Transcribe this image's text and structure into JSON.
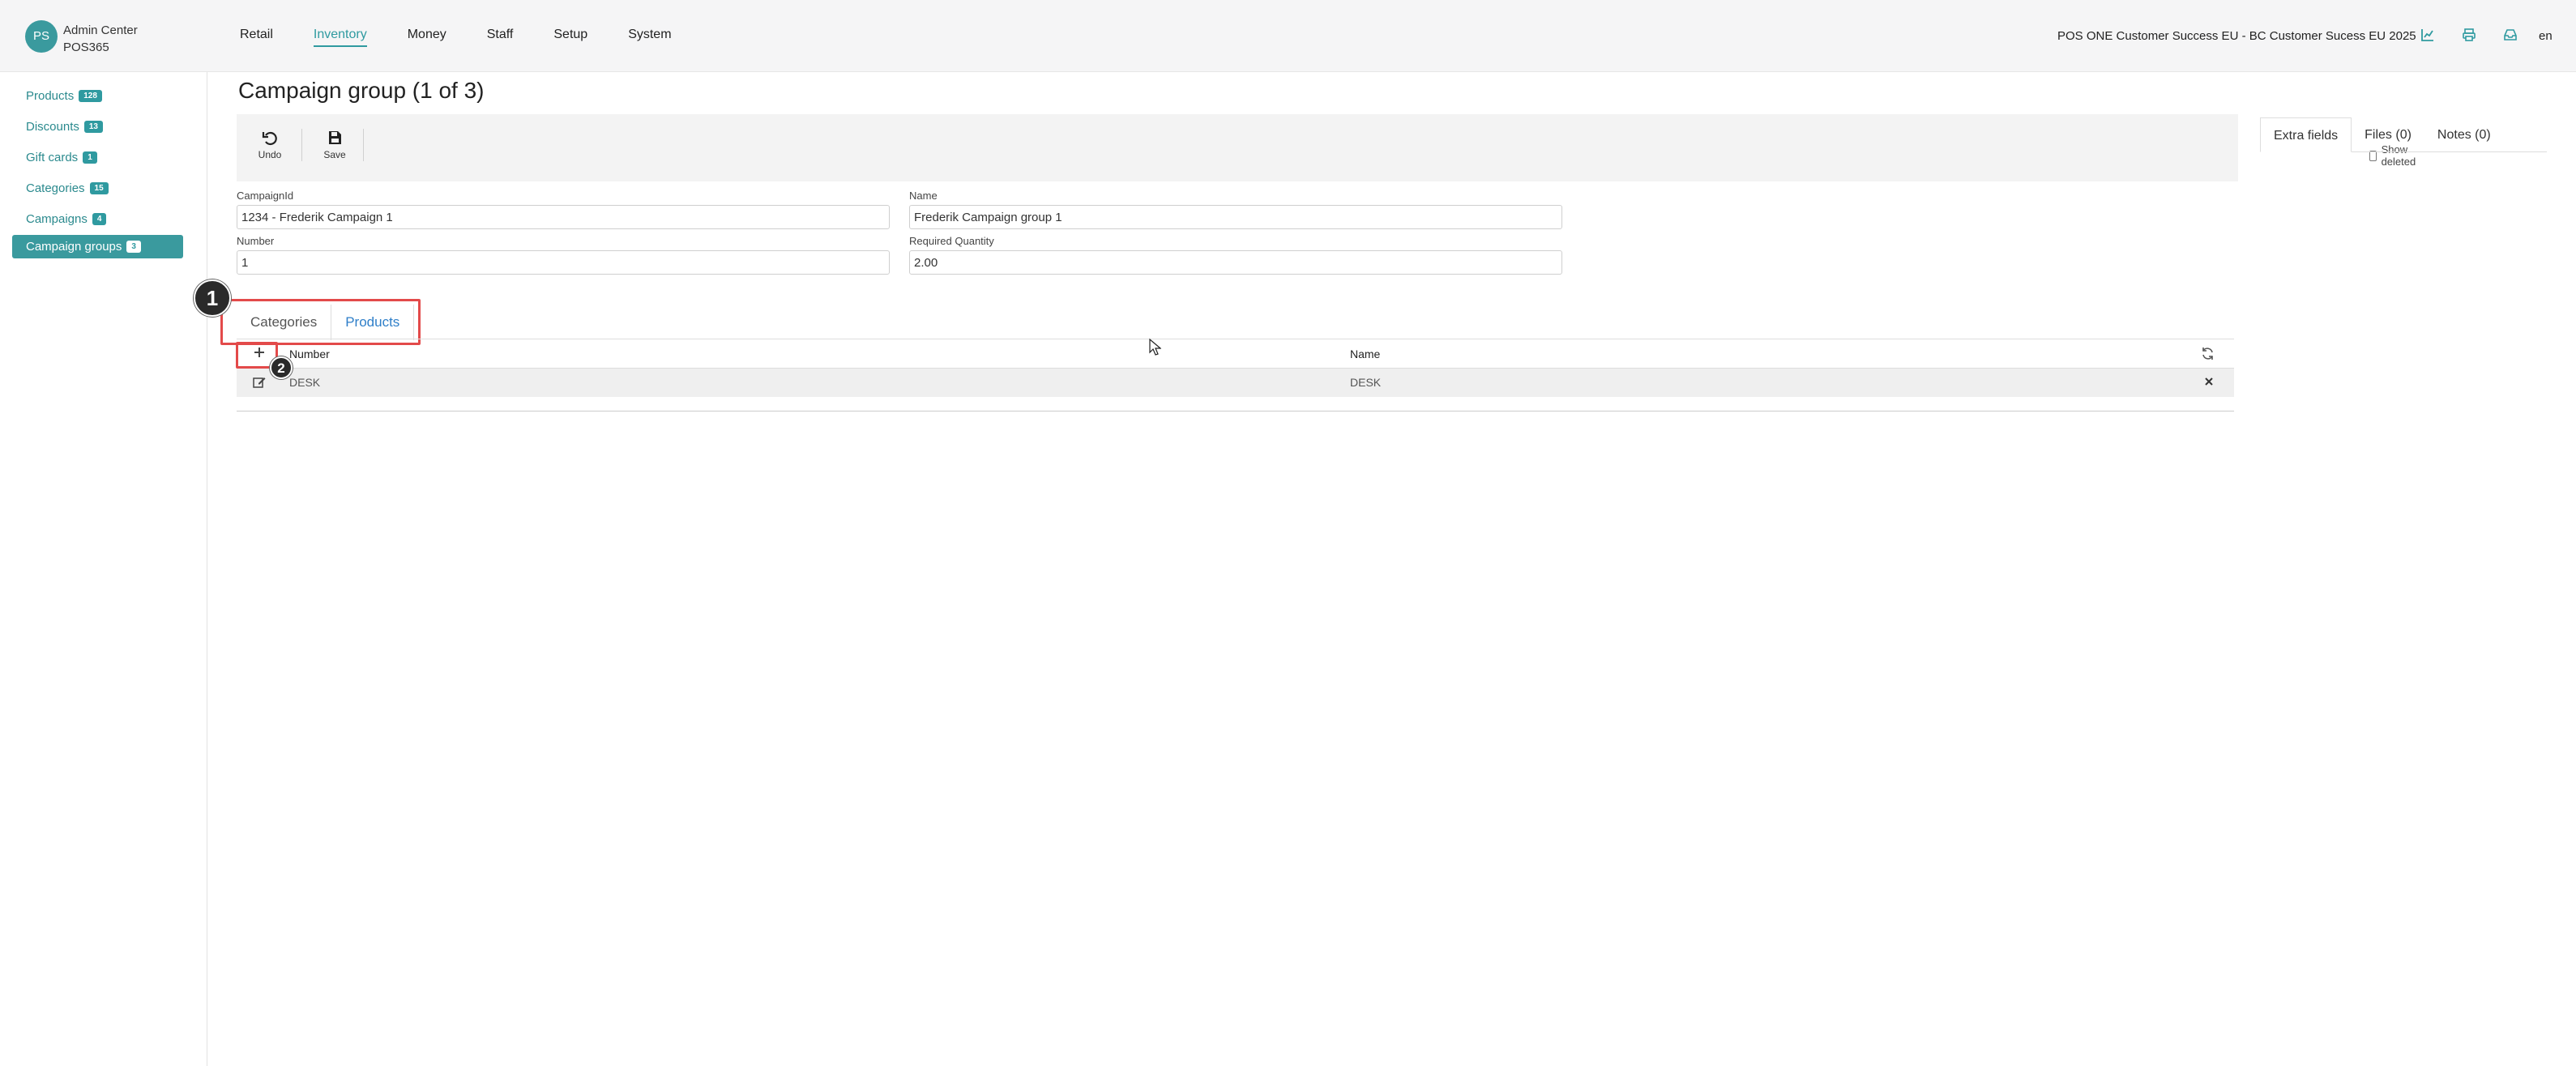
{
  "header": {
    "avatar": "PS",
    "app_name": "Admin Center",
    "tenant": "POS365",
    "nav": [
      "Retail",
      "Inventory",
      "Money",
      "Staff",
      "Setup",
      "System"
    ],
    "active_nav": "Inventory",
    "context_title": "POS ONE Customer Success EU - BC Customer Sucess EU 2025",
    "icons": [
      "chart-icon",
      "print-icon",
      "inbox-icon"
    ],
    "language": "en"
  },
  "sidebar": {
    "items": [
      {
        "label": "Products",
        "count": "128"
      },
      {
        "label": "Discounts",
        "count": "13"
      },
      {
        "label": "Gift cards",
        "count": "1"
      },
      {
        "label": "Categories",
        "count": "15"
      },
      {
        "label": "Campaigns",
        "count": "4"
      },
      {
        "label": "Campaign groups",
        "count": "3"
      }
    ],
    "active": "Campaign groups"
  },
  "main": {
    "title": "Campaign group (1 of 3)",
    "toolbar": {
      "undo_label": "Undo",
      "save_label": "Save",
      "show_deleted_label": "Show deleted"
    },
    "right_tabs": [
      "Extra fields",
      "Files (0)",
      "Notes (0)"
    ],
    "fields": {
      "campaign_id": {
        "label": "CampaignId",
        "value": "1234 - Frederik Campaign 1"
      },
      "name": {
        "label": "Name",
        "value": "Frederik Campaign group 1"
      },
      "number": {
        "label": "Number",
        "value": "1"
      },
      "required_quantity": {
        "label": "Required Quantity",
        "value": "2.00"
      }
    },
    "subtabs": [
      "Categories",
      "Products"
    ],
    "active_subtab": "Products",
    "grid": {
      "columns": [
        "Number",
        "Name"
      ],
      "rows": [
        {
          "number": "DESK",
          "name": "DESK"
        }
      ]
    },
    "annotations": [
      "1",
      "2"
    ]
  },
  "colors": {
    "accent": "#2f9aa0",
    "highlight": "#e34a4a",
    "link": "#2f7fc9"
  }
}
